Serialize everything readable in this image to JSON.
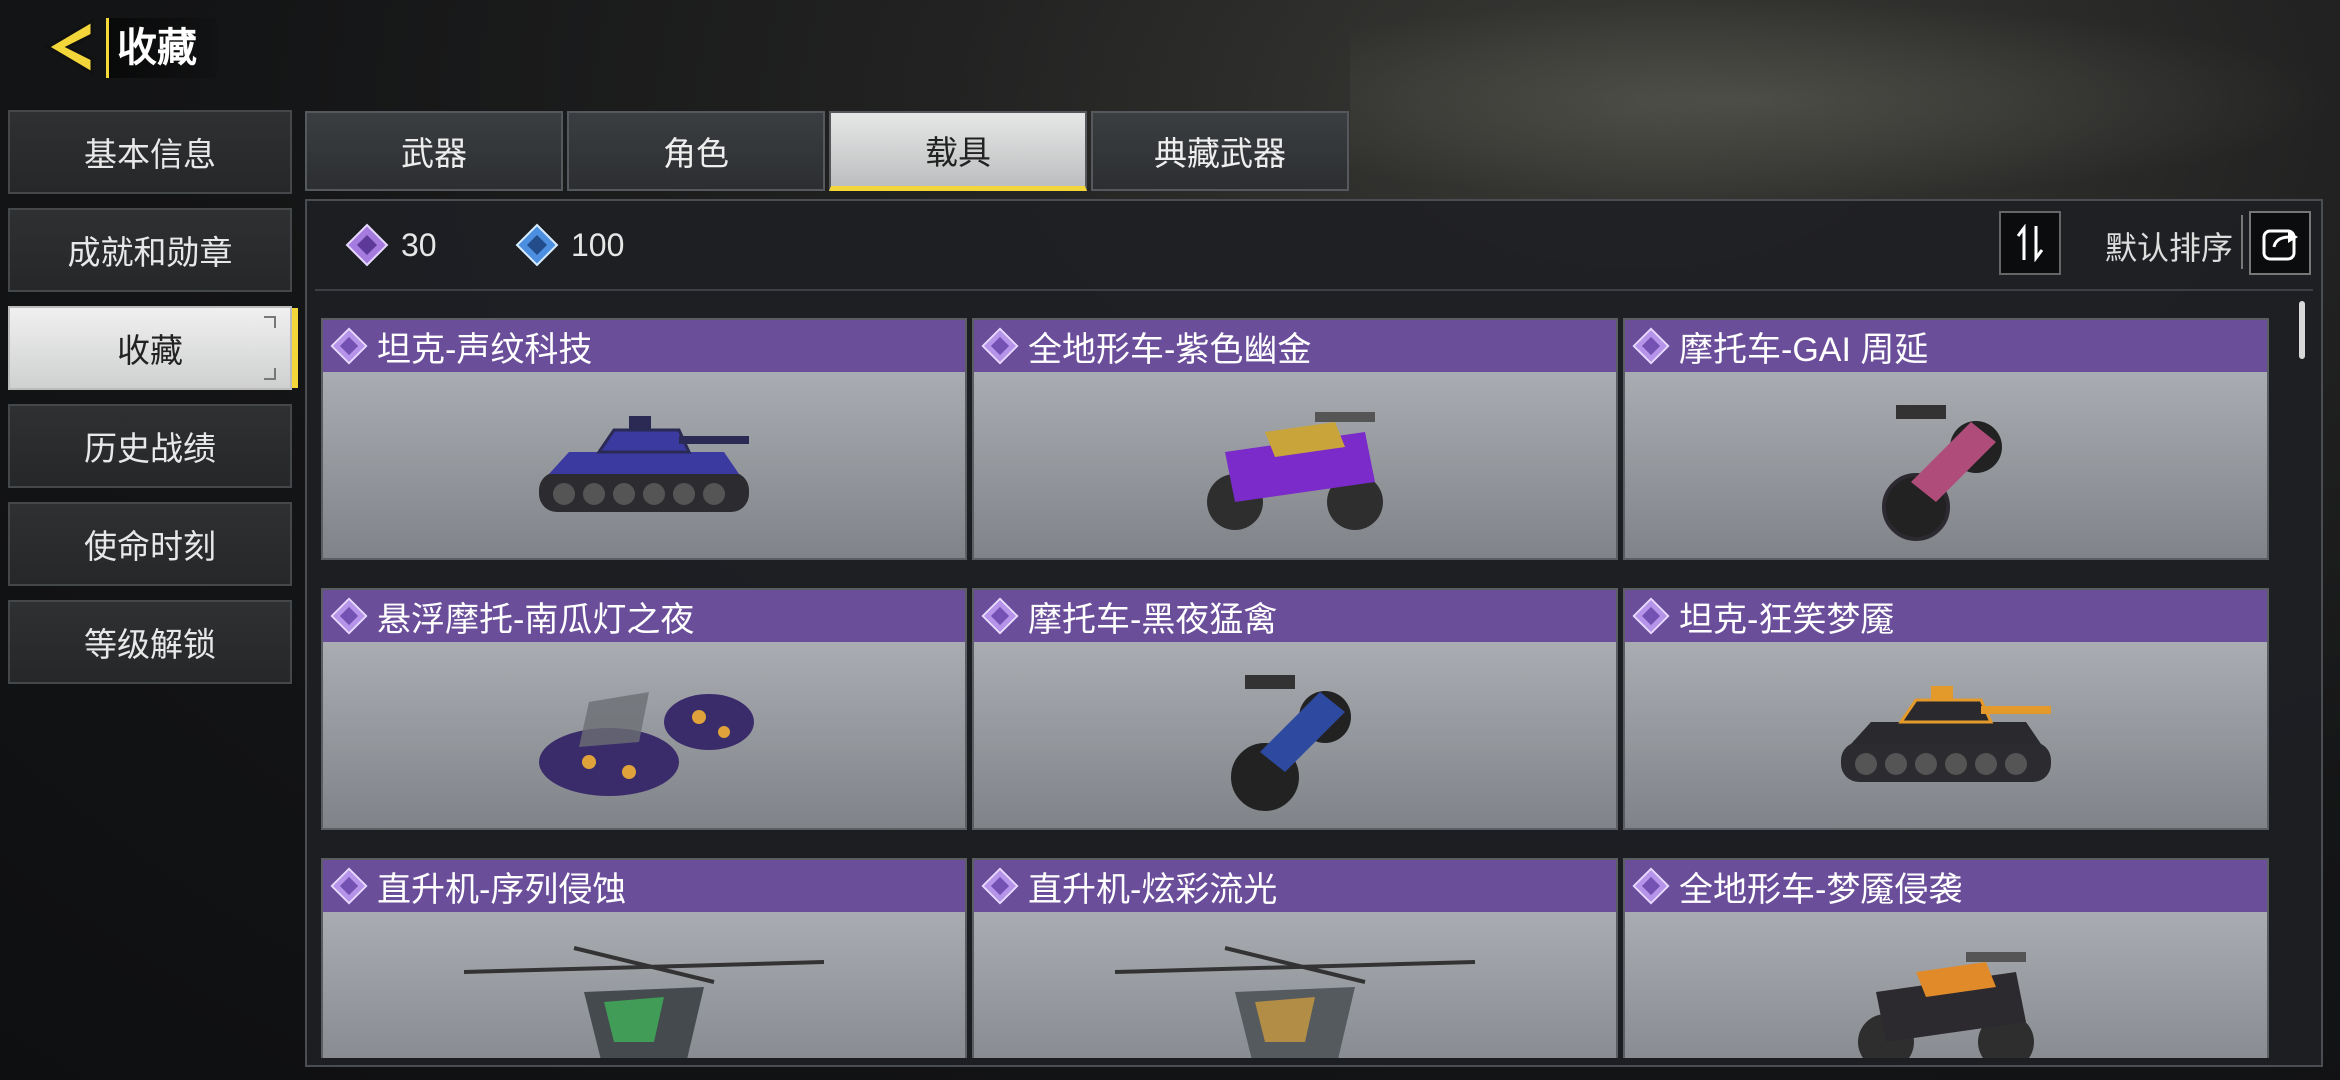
{
  "header": {
    "title": "收藏",
    "back_icon": "back-arrow-icon"
  },
  "sidebar": {
    "items": [
      {
        "label": "基本信息",
        "active": false
      },
      {
        "label": "成就和勋章",
        "active": false
      },
      {
        "label": "收藏",
        "active": true
      },
      {
        "label": "历史战绩",
        "active": false
      },
      {
        "label": "使命时刻",
        "active": false
      },
      {
        "label": "等级解锁",
        "active": false
      }
    ]
  },
  "tabs": [
    {
      "label": "武器",
      "active": false
    },
    {
      "label": "角色",
      "active": false
    },
    {
      "label": "载具",
      "active": true
    },
    {
      "label": "典藏武器",
      "active": false
    }
  ],
  "stats": [
    {
      "value": "30",
      "icon": "purple-gem-icon",
      "color": "#a57be0"
    },
    {
      "value": "100",
      "icon": "blue-gem-icon",
      "color": "#4c8fe0"
    }
  ],
  "sort": {
    "label": "默认排序"
  },
  "colors": {
    "accent": "#f3d63a",
    "card_header": "#6b4e9a"
  },
  "cards": [
    {
      "name": "坦克-声纹科技",
      "type": "tank",
      "body": "#3b3aa0",
      "trim": "#2a2a55"
    },
    {
      "name": "全地形车-紫色幽金",
      "type": "atv",
      "body": "#7b2bc9",
      "trim": "#c9a43a"
    },
    {
      "name": "摩托车-GAI 周延",
      "type": "moto",
      "body": "#b04c7a",
      "trim": "#2c2a30"
    },
    {
      "name": "悬浮摩托-南瓜灯之夜",
      "type": "hover",
      "body": "#3a2c6a",
      "trim": "#e0a23a"
    },
    {
      "name": "摩托车-黑夜猛禽",
      "type": "moto",
      "body": "#2d4aa0",
      "trim": "#222"
    },
    {
      "name": "坦克-狂笑梦魇",
      "type": "tank",
      "body": "#2a2a2e",
      "trim": "#e39a2b"
    },
    {
      "name": "直升机-序列侵蚀",
      "type": "heli",
      "body": "#444a4e",
      "trim": "#3fbf5a"
    },
    {
      "name": "直升机-炫彩流光",
      "type": "heli",
      "body": "#555a5e",
      "trim": "#d9a23a"
    },
    {
      "name": "全地形车-梦魇侵袭",
      "type": "atv",
      "body": "#2c2a2e",
      "trim": "#e08a2a"
    }
  ]
}
